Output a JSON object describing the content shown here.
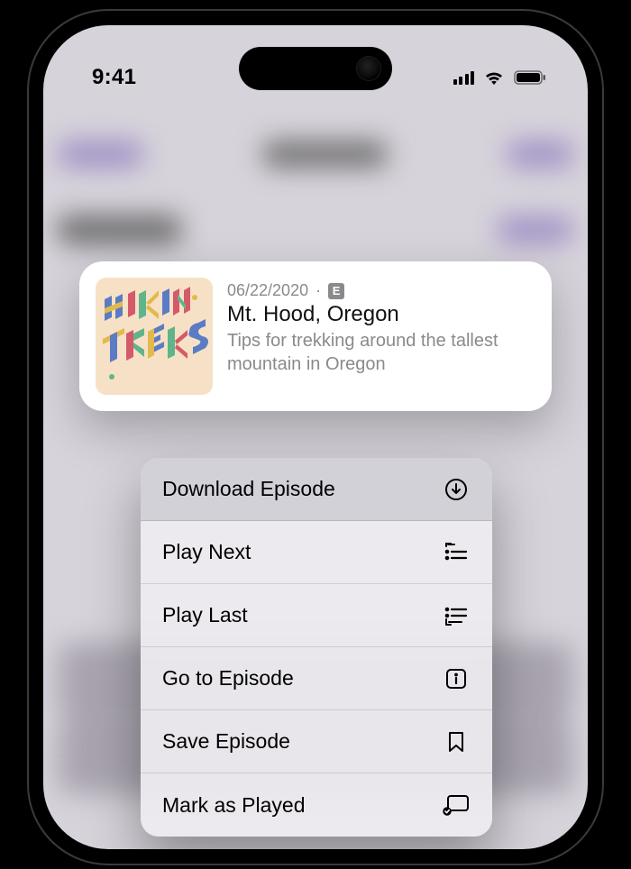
{
  "statusbar": {
    "time": "9:41"
  },
  "episode": {
    "podcast_name": "HIKING TREKS",
    "date": "06/22/2020",
    "explicit_badge": "E",
    "title": "Mt. Hood, Oregon",
    "subtitle": "Tips for trekking around the tallest mountain in Oregon"
  },
  "menu": {
    "items": [
      {
        "label": "Download Episode",
        "icon": "download-circle-icon",
        "highlighted": true
      },
      {
        "label": "Play Next",
        "icon": "play-next-icon",
        "highlighted": false
      },
      {
        "label": "Play Last",
        "icon": "play-last-icon",
        "highlighted": false
      },
      {
        "label": "Go to Episode",
        "icon": "info-square-icon",
        "highlighted": false
      },
      {
        "label": "Save Episode",
        "icon": "bookmark-icon",
        "highlighted": false
      },
      {
        "label": "Mark as Played",
        "icon": "mark-played-icon",
        "highlighted": false
      }
    ]
  }
}
